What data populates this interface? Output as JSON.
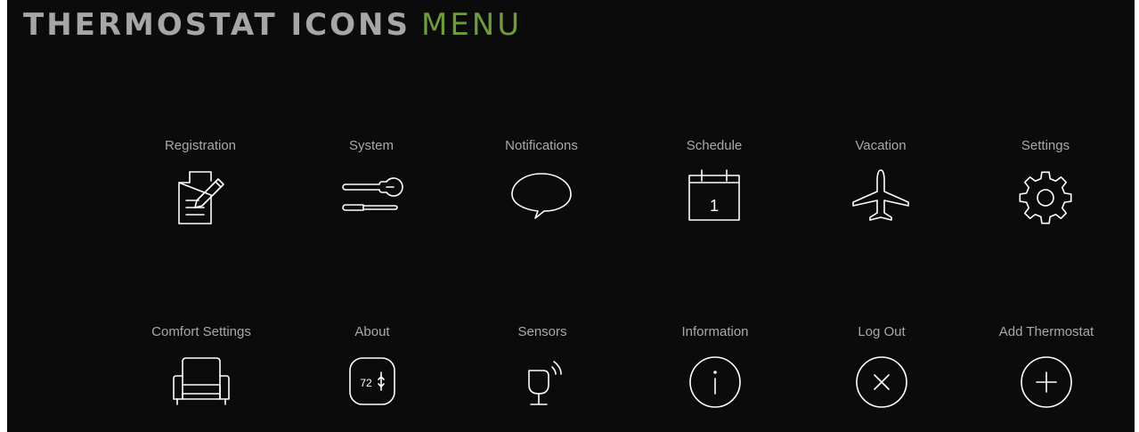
{
  "header": {
    "title_primary": "THERMOSTAT ICONS",
    "title_accent": "MENU"
  },
  "colors": {
    "background": "#0b0b0b",
    "title_gray": "#a6a6a6",
    "accent_green": "#6f9a3e",
    "label_gray": "#a9a9a9",
    "icon_white": "#ffffff"
  },
  "menu": {
    "row1": [
      {
        "label": "Registration",
        "icon": "document-pencil-icon"
      },
      {
        "label": "System",
        "icon": "wrench-screwdriver-icon"
      },
      {
        "label": "Notifications",
        "icon": "speech-bubble-icon"
      },
      {
        "label": "Schedule",
        "icon": "calendar-icon",
        "icon_text": "1"
      },
      {
        "label": "Vacation",
        "icon": "airplane-icon"
      },
      {
        "label": "Settings",
        "icon": "gear-icon"
      }
    ],
    "row2": [
      {
        "label": "Comfort Settings",
        "icon": "armchair-icon"
      },
      {
        "label": "About",
        "icon": "thermostat-icon",
        "icon_text": "72"
      },
      {
        "label": "Sensors",
        "icon": "sensor-icon"
      },
      {
        "label": "Information",
        "icon": "info-icon"
      },
      {
        "label": "Log Out",
        "icon": "close-circle-icon"
      },
      {
        "label": "Add Thermostat",
        "icon": "plus-circle-icon"
      }
    ]
  }
}
